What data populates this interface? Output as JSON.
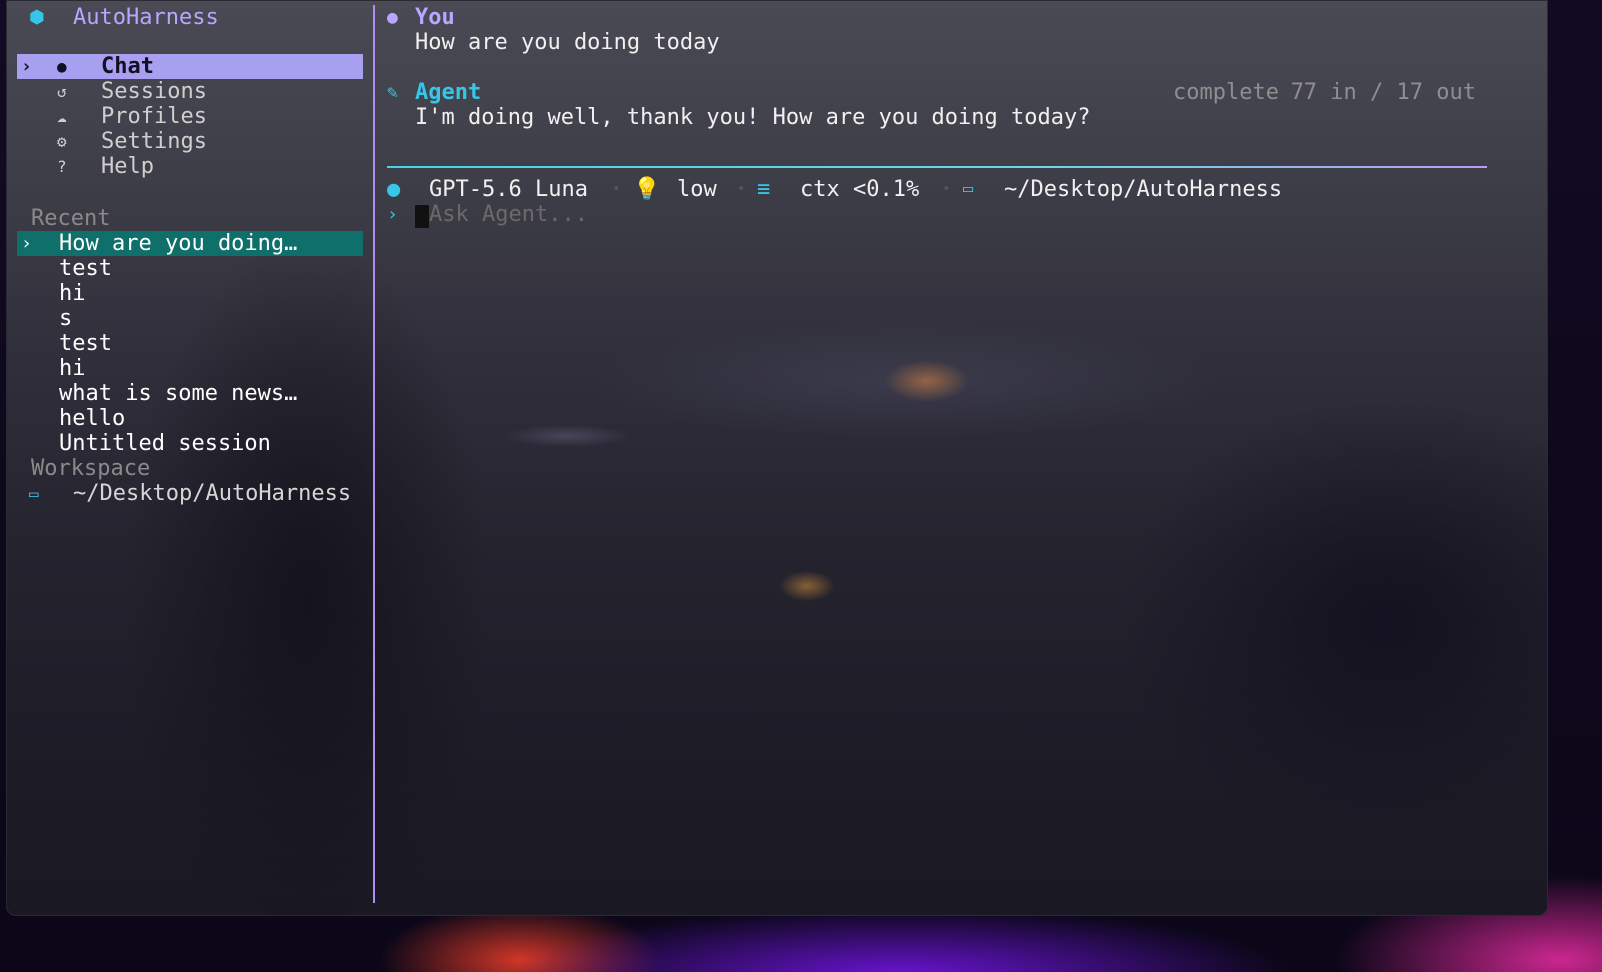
{
  "app": {
    "title": "AutoHarness"
  },
  "nav": [
    {
      "label": "Chat",
      "icon": "chat-bubble-icon",
      "active": true
    },
    {
      "label": "Sessions",
      "icon": "history-icon",
      "active": false
    },
    {
      "label": "Profiles",
      "icon": "cloud-icon",
      "active": false
    },
    {
      "label": "Settings",
      "icon": "gear-icon",
      "active": false
    },
    {
      "label": "Help",
      "icon": "help-icon",
      "active": false
    }
  ],
  "recent": {
    "header": "Recent",
    "items": [
      "How are you doing…",
      "test",
      "hi",
      "s",
      "test",
      "hi",
      "what is some news…",
      "hello",
      "Untitled session"
    ]
  },
  "workspace": {
    "header": "Workspace",
    "path": "~/Desktop/AutoHarness"
  },
  "chat": {
    "user": {
      "role": "You",
      "text": "How are you doing today"
    },
    "agent": {
      "role": "Agent",
      "text": "I'm doing well, thank you! How are you doing today?",
      "status": "complete",
      "tokens": "77 in / 17 out"
    }
  },
  "statusbar": {
    "model": "GPT-5.6 Luna",
    "reasoning": "low",
    "context": "ctx <0.1%",
    "cwd": "~/Desktop/AutoHarness"
  },
  "input": {
    "placeholder": "Ask Agent..."
  },
  "colors": {
    "accent": "#36c6e8",
    "selection": "#a79ff0",
    "recent_selected": "#0f6f6a",
    "role_user": "#b8a6ff",
    "role_agent": "#36c6e8"
  }
}
